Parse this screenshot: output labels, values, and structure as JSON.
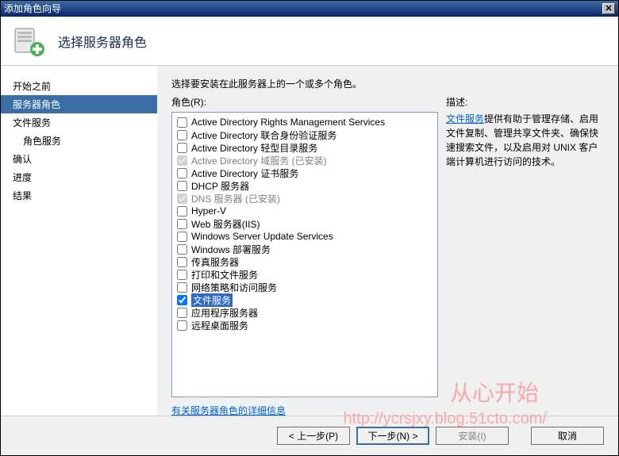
{
  "title": "添加角色向导",
  "header": {
    "title": "选择服务器角色"
  },
  "nav": {
    "items": [
      {
        "label": "开始之前",
        "indent": false
      },
      {
        "label": "服务器角色",
        "indent": false,
        "active": true
      },
      {
        "label": "文件服务",
        "indent": false
      },
      {
        "label": "角色服务",
        "indent": true
      },
      {
        "label": "确认",
        "indent": false
      },
      {
        "label": "进度",
        "indent": false
      },
      {
        "label": "结果",
        "indent": false
      }
    ]
  },
  "content": {
    "instruction": "选择要安装在此服务器上的一个或多个角色。",
    "roles_label": "角色(R):",
    "desc_label": "描述:",
    "roles": [
      {
        "label": "Active Directory Rights Management Services",
        "checked": false,
        "disabled": false
      },
      {
        "label": "Active Directory 联合身份验证服务",
        "checked": false,
        "disabled": false
      },
      {
        "label": "Active Directory 轻型目录服务",
        "checked": false,
        "disabled": false
      },
      {
        "label": "Active Directory 域服务  (已安装)",
        "checked": true,
        "disabled": true
      },
      {
        "label": "Active Directory 证书服务",
        "checked": false,
        "disabled": false
      },
      {
        "label": "DHCP 服务器",
        "checked": false,
        "disabled": false
      },
      {
        "label": "DNS 服务器  (已安装)",
        "checked": true,
        "disabled": true
      },
      {
        "label": "Hyper-V",
        "checked": false,
        "disabled": false
      },
      {
        "label": "Web 服务器(IIS)",
        "checked": false,
        "disabled": false
      },
      {
        "label": "Windows Server Update Services",
        "checked": false,
        "disabled": false
      },
      {
        "label": "Windows 部署服务",
        "checked": false,
        "disabled": false
      },
      {
        "label": "传真服务器",
        "checked": false,
        "disabled": false
      },
      {
        "label": "打印和文件服务",
        "checked": false,
        "disabled": false
      },
      {
        "label": "网络策略和访问服务",
        "checked": false,
        "disabled": false
      },
      {
        "label": "文件服务",
        "checked": true,
        "disabled": false,
        "selected": true
      },
      {
        "label": "应用程序服务器",
        "checked": false,
        "disabled": false
      },
      {
        "label": "远程桌面服务",
        "checked": false,
        "disabled": false
      }
    ],
    "description": {
      "link_text": "文件服务",
      "body": "提供有助于管理存储、启用文件复制、管理共享文件夹、确保快速搜索文件，以及启用对 UNIX 客户端计算机进行访问的技术。"
    },
    "more_info": "有关服务器角色的详细信息"
  },
  "buttons": {
    "prev": "< 上一步(P)",
    "next": "下一步(N) >",
    "install": "安装(I)",
    "cancel": "取消"
  },
  "watermark": {
    "text": "从心开始",
    "url": "http://ycrsjxy.blog.51cto.com/"
  }
}
